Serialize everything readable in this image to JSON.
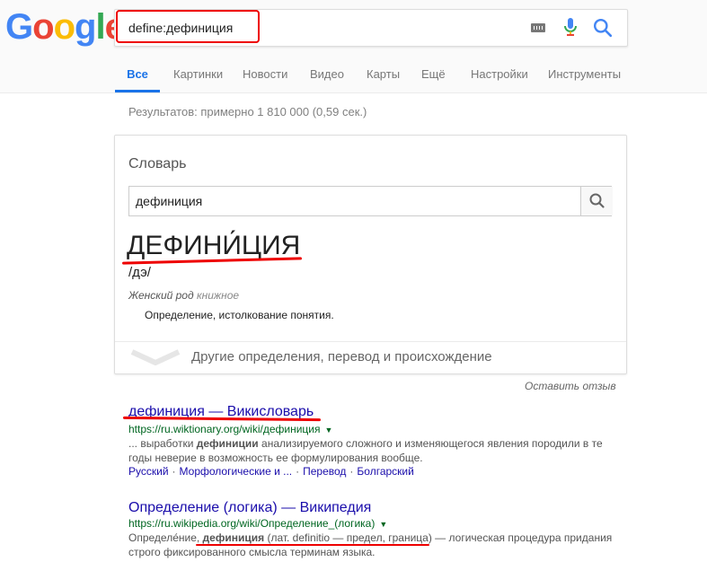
{
  "logo": {
    "text": [
      "G",
      "o",
      "o",
      "g",
      "l",
      "e"
    ],
    "colors": [
      "#4285f4",
      "#ea4335",
      "#fbbc05",
      "#4285f4",
      "#34a853",
      "#ea4335"
    ]
  },
  "search": {
    "query": "define:дефиниция"
  },
  "icons": {
    "keyboard": "keyboard-icon",
    "mic": "mic-icon",
    "search": "search-icon"
  },
  "tabs": [
    {
      "label": "Все",
      "active": true
    },
    {
      "label": "Картинки"
    },
    {
      "label": "Новости"
    },
    {
      "label": "Видео"
    },
    {
      "label": "Карты"
    },
    {
      "label": "Ещё"
    },
    {
      "label": "Настройки"
    },
    {
      "label": "Инструменты"
    }
  ],
  "results_count": "Результатов: примерно 1 810 000 (0,59 сек.)",
  "dictionary": {
    "title": "Словарь",
    "input_value": "дефиниция",
    "headword": "ДЕФИНИ́ЦИЯ",
    "pronunciation": "/дэ/",
    "gender": "Женский род",
    "register": "книжное",
    "definition": "Определение, истолкование понятия.",
    "more_label": "Другие определения, перевод и происхождение"
  },
  "feedback": "Оставить отзыв",
  "results": [
    {
      "title": "дефиниция — Викисловарь",
      "url": "https://ru.wiktionary.org/wiki/дефиниция",
      "snippet_parts": [
        {
          "text": "... выработки ",
          "bold": false
        },
        {
          "text": "дефиниции",
          "bold": true
        },
        {
          "text": " анализируемого сложного и изменяющегося явления породили в те годы неверие в возможность ее формулирования вообще.",
          "bold": false
        }
      ],
      "links": [
        "Русский",
        "Морфологические и ...",
        "Перевод",
        "Болгарский"
      ]
    },
    {
      "title": "Определение (логика) — Википедия",
      "url": "https://ru.wikipedia.org/wiki/Определение_(логика)",
      "snippet_parts": [
        {
          "text": "Определе́ние, ",
          "bold": false
        },
        {
          "text": "дефиниция",
          "bold": true
        },
        {
          "text": " (лат. definitio — предел, граница) — логическая процедура придания строго фиксированного смысла терминам языка.",
          "bold": false
        }
      ]
    }
  ],
  "accent_colors": {
    "annotation_red": "#e00000",
    "link": "#1a0dab",
    "url": "#006621",
    "tab_active": "#1a73e8"
  }
}
